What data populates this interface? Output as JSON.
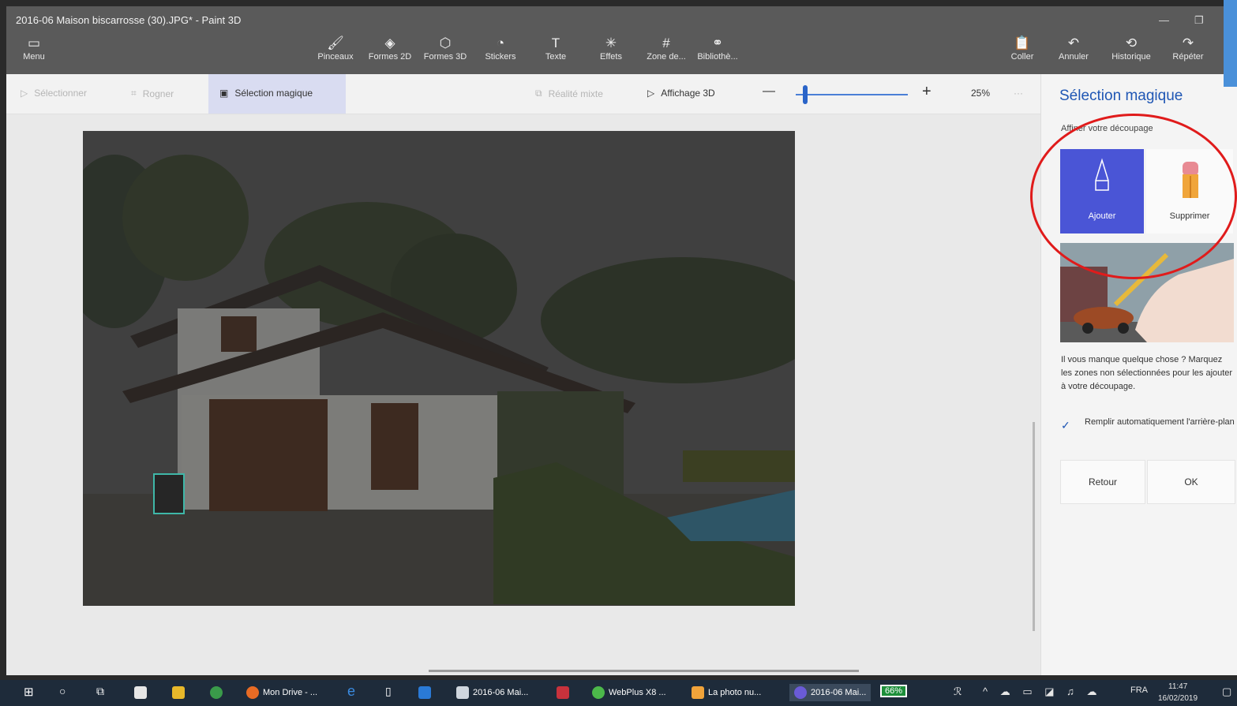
{
  "window": {
    "title": "2016-06 Maison biscarrosse (30).JPG* - Paint 3D",
    "minimize": "—",
    "restore": "❐"
  },
  "toolbar": {
    "menu": "Menu",
    "items": [
      "Pinceaux",
      "Formes 2D",
      "Formes 3D",
      "Stickers",
      "Texte",
      "Effets",
      "Zone de...",
      "Bibliothè..."
    ],
    "right": [
      "Coller",
      "Annuler",
      "Historique",
      "Répéter"
    ]
  },
  "subtoolbar": {
    "select": "Sélectionner",
    "crop": "Rogner",
    "magic": "Sélection magique",
    "mixed": "Réalité mixte",
    "view3d": "Affichage 3D",
    "minus": "—",
    "plus": "+",
    "zoom": "25%",
    "more": "···"
  },
  "panel": {
    "title": "Sélection magique",
    "subtitle": "Affiner votre découpage",
    "add": "Ajouter",
    "remove": "Supprimer",
    "help": "Il vous manque quelque chose ? Marquez les zones non sélectionnées pour les ajouter à votre découpage.",
    "autofill": "Remplir automatiquement l'arrière-plan",
    "back": "Retour",
    "ok": "OK"
  },
  "taskbar": {
    "items": [
      "Mon Drive - ...",
      "2016-06 Mai...",
      "WebPlus X8 ...",
      "La photo nu...",
      "2016-06 Mai..."
    ],
    "battery": "66%",
    "lang": "FRA",
    "time": "11:47",
    "date": "16/02/2019"
  },
  "colors": {
    "accent": "#1f56b4",
    "add_card": "#4a55d6",
    "annotation": "#e01b1b",
    "titlebar": "#5a5a5a",
    "taskbar": "#1e2b3a"
  }
}
